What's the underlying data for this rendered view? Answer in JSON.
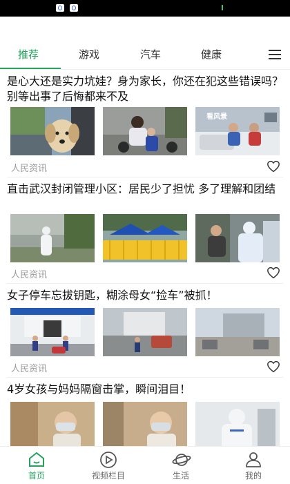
{
  "tabs": [
    {
      "label": "推荐",
      "active": true
    },
    {
      "label": "游戏",
      "active": false
    },
    {
      "label": "汽车",
      "active": false
    },
    {
      "label": "健康",
      "active": false
    }
  ],
  "articles": [
    {
      "title": "是心大还是实力坑娃？身为家长，你还在犯这些错误吗？别等出事了后悔都来不及",
      "source": "人民资讯",
      "thumb_labels": [
        "",
        "",
        "看风景"
      ]
    },
    {
      "title": "直击武汉封闭管理小区：居民少了担忧 多了理解和团结",
      "source": "人民资讯"
    },
    {
      "title": "女子停车忘拔钥匙，糊涂母女“捡车”被抓！",
      "source": "人民资讯"
    },
    {
      "title": "4岁女孩与妈妈隔窗击掌，瞬间泪目！"
    }
  ],
  "bottom_nav": [
    {
      "label": "首页",
      "icon": "home-icon",
      "active": true
    },
    {
      "label": "视频栏目",
      "icon": "play-icon",
      "active": false
    },
    {
      "label": "生活",
      "icon": "planet-icon",
      "active": false
    },
    {
      "label": "我的",
      "icon": "user-icon",
      "active": false
    }
  ],
  "colors": {
    "accent": "#23a35b",
    "source_text": "#999999"
  }
}
